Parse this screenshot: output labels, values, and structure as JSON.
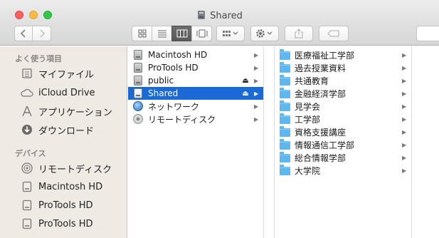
{
  "window": {
    "title": "Shared",
    "title_icon": "network-volume-icon"
  },
  "toolbar": {
    "back_icon": "chevron-left-icon",
    "forward_icon": "chevron-right-icon",
    "view_modes": [
      "icon-view",
      "list-view",
      "column-view",
      "cover-flow-view"
    ],
    "active_view": "column-view",
    "arrange_icon": "arrange-grid-icon",
    "action_icon": "gear-icon",
    "share_icon": "share-icon",
    "tags_icon": "tag-icon"
  },
  "sidebar": {
    "favorites_heading": "よく使う項目",
    "favorites": [
      {
        "label": "マイファイル",
        "icon": "all-my-files-icon"
      },
      {
        "label": "iCloud Drive",
        "icon": "cloud-icon"
      },
      {
        "label": "アプリケーション",
        "icon": "applications-icon"
      },
      {
        "label": "ダウンロード",
        "icon": "downloads-icon"
      }
    ],
    "devices_heading": "デバイス",
    "devices": [
      {
        "label": "リモートディスク",
        "icon": "remote-disc-icon"
      },
      {
        "label": "Macintosh HD",
        "icon": "hard-drive-icon"
      },
      {
        "label": "ProTools HD",
        "icon": "hard-drive-icon"
      },
      {
        "label": "ProTools HD",
        "icon": "hard-drive-icon"
      }
    ]
  },
  "column1": {
    "items": [
      {
        "label": "Macintosh HD",
        "icon": "hard-drive-icon",
        "eject": false,
        "selected": false
      },
      {
        "label": "ProTools HD",
        "icon": "hard-drive-icon",
        "eject": false,
        "selected": false
      },
      {
        "label": "public",
        "icon": "network-volume-icon",
        "eject": true,
        "selected": false
      },
      {
        "label": "Shared",
        "icon": "network-volume-icon",
        "eject": true,
        "selected": true
      },
      {
        "label": "ネットワーク",
        "icon": "network-globe-icon",
        "eject": false,
        "selected": false
      },
      {
        "label": "リモートディスク",
        "icon": "remote-disc-icon",
        "eject": false,
        "selected": false
      }
    ],
    "eject_glyph": "⏏",
    "chevron_glyph": "▶"
  },
  "column2": {
    "items": [
      {
        "label": "医療福祉工学部"
      },
      {
        "label": "過去授業資料"
      },
      {
        "label": "共通教育"
      },
      {
        "label": "金融経済学部"
      },
      {
        "label": "見学会"
      },
      {
        "label": "工学部"
      },
      {
        "label": "資格支援講座"
      },
      {
        "label": "情報通信工学部"
      },
      {
        "label": "総合情報学部"
      },
      {
        "label": "大学院"
      }
    ],
    "chevron_glyph": "▶"
  },
  "colors": {
    "selection": "#1a69d4",
    "folder": "#5eb7ef",
    "sidebar_bg": "#f0eae4"
  }
}
